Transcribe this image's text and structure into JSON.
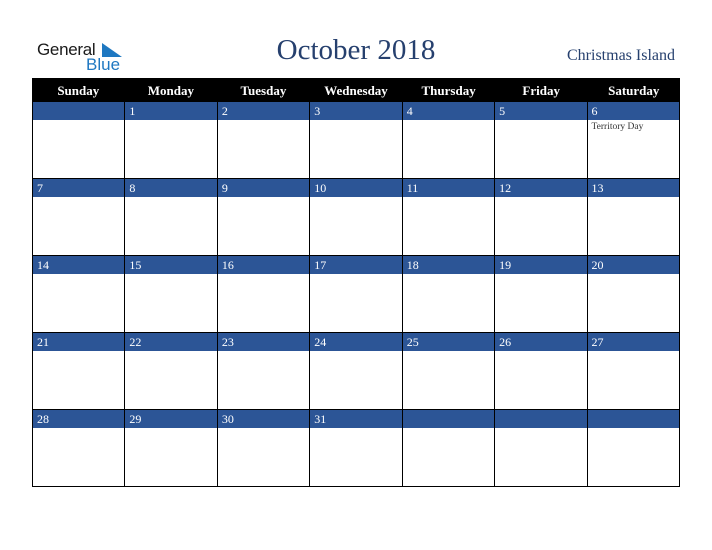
{
  "logo": {
    "line1": "General",
    "line2": "Blue",
    "icon": "triangle-flag-icon"
  },
  "title": "October 2018",
  "region": "Christmas Island",
  "colors": {
    "title": "#26406e",
    "day_band": "#2c5596",
    "header_bg": "#000000",
    "logo_blue": "#1f78c1"
  },
  "weekdays": [
    "Sunday",
    "Monday",
    "Tuesday",
    "Wednesday",
    "Thursday",
    "Friday",
    "Saturday"
  ],
  "weeks": [
    [
      {
        "day": "",
        "event": ""
      },
      {
        "day": "1",
        "event": ""
      },
      {
        "day": "2",
        "event": ""
      },
      {
        "day": "3",
        "event": ""
      },
      {
        "day": "4",
        "event": ""
      },
      {
        "day": "5",
        "event": ""
      },
      {
        "day": "6",
        "event": "Territory Day"
      }
    ],
    [
      {
        "day": "7",
        "event": ""
      },
      {
        "day": "8",
        "event": ""
      },
      {
        "day": "9",
        "event": ""
      },
      {
        "day": "10",
        "event": ""
      },
      {
        "day": "11",
        "event": ""
      },
      {
        "day": "12",
        "event": ""
      },
      {
        "day": "13",
        "event": ""
      }
    ],
    [
      {
        "day": "14",
        "event": ""
      },
      {
        "day": "15",
        "event": ""
      },
      {
        "day": "16",
        "event": ""
      },
      {
        "day": "17",
        "event": ""
      },
      {
        "day": "18",
        "event": ""
      },
      {
        "day": "19",
        "event": ""
      },
      {
        "day": "20",
        "event": ""
      }
    ],
    [
      {
        "day": "21",
        "event": ""
      },
      {
        "day": "22",
        "event": ""
      },
      {
        "day": "23",
        "event": ""
      },
      {
        "day": "24",
        "event": ""
      },
      {
        "day": "25",
        "event": ""
      },
      {
        "day": "26",
        "event": ""
      },
      {
        "day": "27",
        "event": ""
      }
    ],
    [
      {
        "day": "28",
        "event": ""
      },
      {
        "day": "29",
        "event": ""
      },
      {
        "day": "30",
        "event": ""
      },
      {
        "day": "31",
        "event": ""
      },
      {
        "day": "",
        "event": ""
      },
      {
        "day": "",
        "event": ""
      },
      {
        "day": "",
        "event": ""
      }
    ]
  ]
}
